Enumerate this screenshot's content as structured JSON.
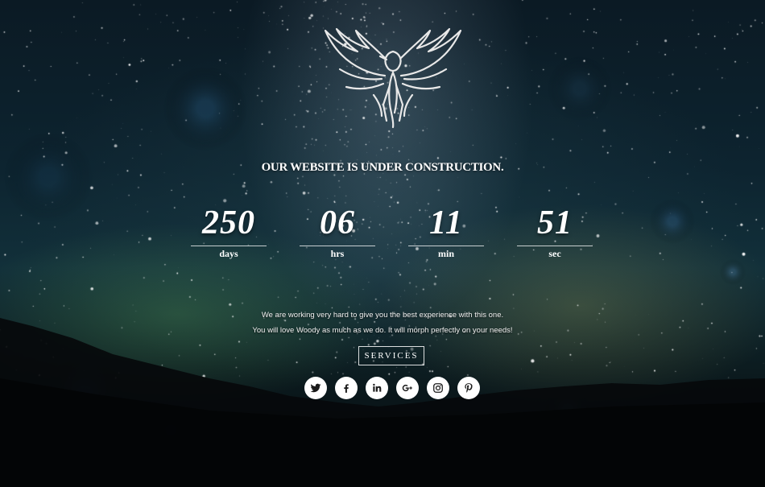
{
  "page": {
    "title": "OUR WEBSITE IS UNDER CONSTRUCTION."
  },
  "countdown": [
    {
      "value": "250",
      "label": "days"
    },
    {
      "value": "06",
      "label": "hrs"
    },
    {
      "value": "11",
      "label": "min"
    },
    {
      "value": "51",
      "label": "sec"
    }
  ],
  "message": {
    "line1": "We are working very hard to give you the best experience with this one.",
    "line2": "You will love Woody as much as we do. It will morph perfectly on your needs!"
  },
  "cta": {
    "services_label": "SERVICES"
  },
  "social": [
    {
      "name": "twitter",
      "icon": "twitter-icon"
    },
    {
      "name": "facebook",
      "icon": "facebook-icon"
    },
    {
      "name": "linkedin",
      "icon": "linkedin-icon"
    },
    {
      "name": "google-plus",
      "icon": "google-plus-icon"
    },
    {
      "name": "instagram",
      "icon": "instagram-icon"
    },
    {
      "name": "pinterest",
      "icon": "pinterest-icon"
    }
  ],
  "logo": {
    "icon": "phoenix-icon"
  },
  "colors": {
    "text": "#ffffff",
    "icon_bg": "#ffffff",
    "icon_fg": "#1a1a1a",
    "sky_top": "#0b1a24",
    "ground": "#05090c"
  }
}
